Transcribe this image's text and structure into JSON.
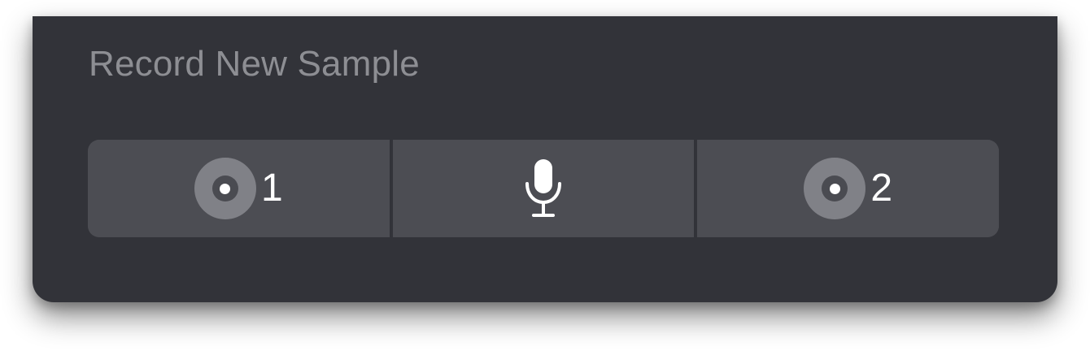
{
  "panel": {
    "title": "Record New Sample"
  },
  "segments": [
    {
      "label": "1",
      "icon": "input-1-icon"
    },
    {
      "icon": "microphone-icon"
    },
    {
      "label": "2",
      "icon": "input-2-icon"
    }
  ],
  "colors": {
    "panel_background": "#323339",
    "segment_background": "#4c4d53",
    "title_text": "#8d8e93",
    "badge": "#808187",
    "icon_foreground": "#ffffff"
  }
}
